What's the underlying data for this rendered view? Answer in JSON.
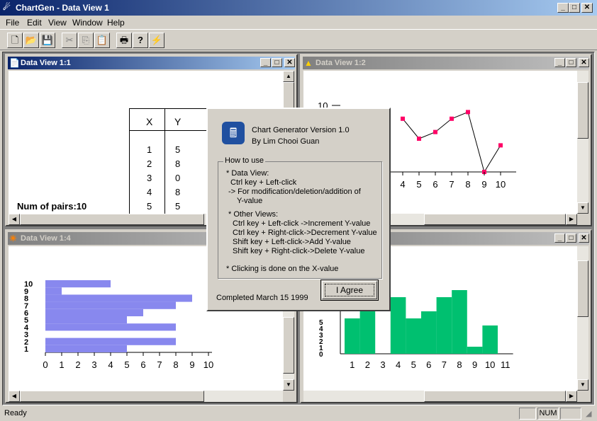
{
  "app": {
    "title": "ChartGen - Data View 1"
  },
  "menu": [
    "File",
    "Edit",
    "View",
    "Window",
    "Help"
  ],
  "toolbar": [
    "new-icon",
    "open-icon",
    "save-icon",
    "cut-icon",
    "copy-icon",
    "paste-icon",
    "print-icon",
    "help-icon",
    "pointer-help-icon"
  ],
  "windows": {
    "w1": {
      "title": "Data View 1:1"
    },
    "w2": {
      "title": "Data View 1:2"
    },
    "w4": {
      "title": "Data View 1:4"
    }
  },
  "table": {
    "headers": [
      "X",
      "Y"
    ],
    "rows": [
      [
        "1",
        "5"
      ],
      [
        "2",
        "8"
      ],
      [
        "3",
        "0"
      ],
      [
        "4",
        "8"
      ],
      [
        "5",
        "5"
      ]
    ],
    "pairs_label": "Num of pairs:10"
  },
  "chart_data": [
    {
      "type": "line",
      "x": [
        4,
        5,
        6,
        7,
        8,
        9,
        10
      ],
      "y": [
        8,
        5,
        6,
        8,
        9,
        0,
        4
      ],
      "xticks": [
        "4",
        "5",
        "6",
        "7",
        "8",
        "9",
        "10"
      ],
      "ytick_visible": "10",
      "marker_color": "#ff0066"
    },
    {
      "type": "bar",
      "orientation": "horizontal",
      "categories": [
        "1",
        "2",
        "3",
        "4",
        "5",
        "6",
        "7",
        "8",
        "9",
        "10"
      ],
      "values": [
        5,
        8,
        0,
        8,
        5,
        6,
        8,
        9,
        1,
        4
      ],
      "xticks": [
        "0",
        "1",
        "2",
        "3",
        "4",
        "5",
        "6",
        "7",
        "8",
        "9",
        "10"
      ],
      "yticks": [
        "1",
        "2",
        "3",
        "4",
        "5",
        "6",
        "7",
        "8",
        "9",
        "10"
      ],
      "xlim": [
        0,
        10
      ],
      "color": "#8888ee"
    },
    {
      "type": "bar",
      "categories": [
        "1",
        "2",
        "3",
        "4",
        "5",
        "6",
        "7",
        "8",
        "9",
        "10"
      ],
      "values": [
        5,
        8,
        0,
        8,
        5,
        6,
        8,
        9,
        1,
        4
      ],
      "xticks": [
        "1",
        "2",
        "3",
        "4",
        "5",
        "6",
        "7",
        "8",
        "9",
        "10",
        "11"
      ],
      "yticks": [
        "0",
        "1",
        "2",
        "3",
        "4",
        "5"
      ],
      "color": "#00c070"
    }
  ],
  "dialog": {
    "title": "Chart Generator Version 1.0",
    "author": "By Lim Chooi Guan",
    "group_title": "How to use",
    "lines": [
      "* Data View:",
      "Ctrl key + Left-click",
      "-> For modification/deletion/addition of",
      "Y-value",
      "* Other Views:",
      "Ctrl key + Left-click  ->Increment Y-value",
      "Ctrl key + Right-click->Decrement Y-value",
      "Shift key + Left-click->Add Y-value",
      "Shift key + Right-click->Delete Y-value",
      "* Clicking is done on the X-value"
    ],
    "completed": "Completed March 15 1999",
    "button": "I Agree"
  },
  "status": {
    "text": "Ready",
    "num": "NUM"
  }
}
